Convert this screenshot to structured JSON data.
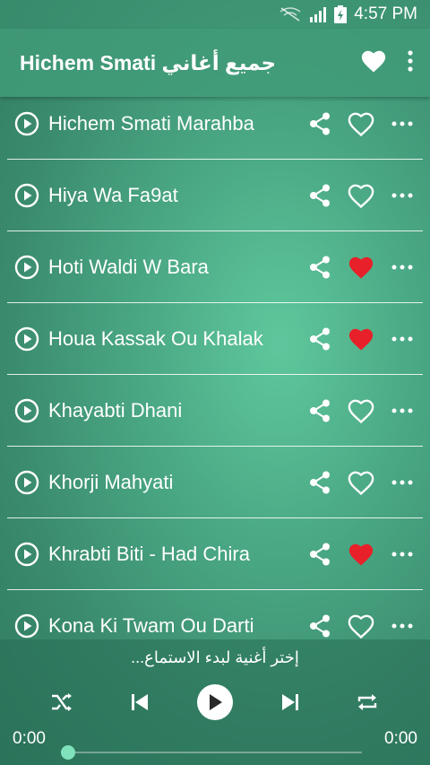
{
  "status_bar": {
    "time": "4:57 PM"
  },
  "app_bar": {
    "title": "Hichem Smati جميع أغاني"
  },
  "songs": [
    {
      "title": "Hichem Smati Marahba",
      "favorite": false
    },
    {
      "title": "Hiya Wa Fa9at",
      "favorite": false
    },
    {
      "title": "Hoti Waldi W Bara",
      "favorite": true
    },
    {
      "title": "Houa Kassak Ou Khalak",
      "favorite": true
    },
    {
      "title": "Khayabti Dhani",
      "favorite": false
    },
    {
      "title": "Khorji Mahyati",
      "favorite": false
    },
    {
      "title": "Khrabti Biti - Had Chira",
      "favorite": true
    },
    {
      "title": "Kona Ki Twam Ou Darti",
      "favorite": false
    }
  ],
  "player": {
    "prompt": "إختر أغنية لبدء الاستماع...",
    "current_time": "0:00",
    "total_time": "0:00",
    "progress": 0
  },
  "colors": {
    "favorite_active": "#e8202a",
    "accent": "#7fe2bb"
  },
  "icons": [
    "battery-icon",
    "signal-icon",
    "wifi-off-icon",
    "heart-icon",
    "more-vert-icon",
    "play-circle-icon",
    "share-icon",
    "more-horiz-icon",
    "shuffle-icon",
    "previous-icon",
    "play-icon",
    "next-icon",
    "repeat-icon"
  ]
}
